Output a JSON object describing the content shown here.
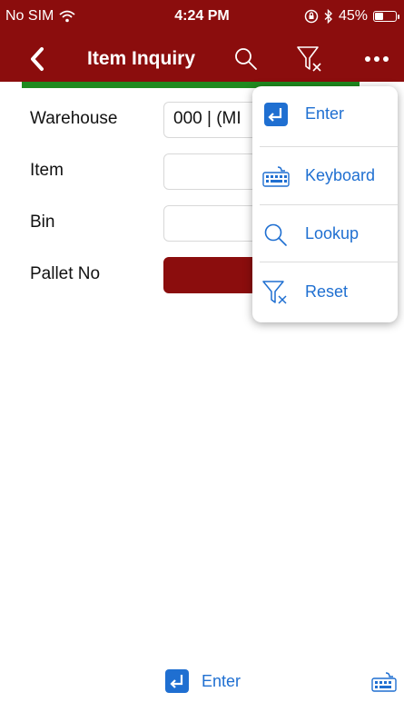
{
  "status_bar": {
    "carrier": "No SIM",
    "time": "4:24 PM",
    "battery_percent": "45%",
    "battery_level": 0.45
  },
  "nav": {
    "title": "Item Inquiry",
    "back_icon": "chevron-left-icon",
    "search_icon": "search-icon",
    "filter_icon": "filter-reset-icon",
    "more_icon": "more-icon"
  },
  "form": {
    "fields": [
      {
        "label": "Warehouse",
        "value": "000 | (MI"
      },
      {
        "label": "Item",
        "value": ""
      },
      {
        "label": "Bin",
        "value": ""
      },
      {
        "label": "Pallet No",
        "value": ""
      }
    ]
  },
  "dropdown": {
    "items": [
      {
        "label": "Enter",
        "icon": "enter-icon"
      },
      {
        "label": "Keyboard",
        "icon": "keyboard-icon"
      },
      {
        "label": "Lookup",
        "icon": "search-icon"
      },
      {
        "label": "Reset",
        "icon": "filter-reset-icon"
      }
    ]
  },
  "bottom_bar": {
    "enter_label": "Enter",
    "keyboard_icon": "keyboard-icon"
  },
  "colors": {
    "brand": "#8b0d0d",
    "accent": "#1f6fd1",
    "success": "#1f8a1f"
  }
}
